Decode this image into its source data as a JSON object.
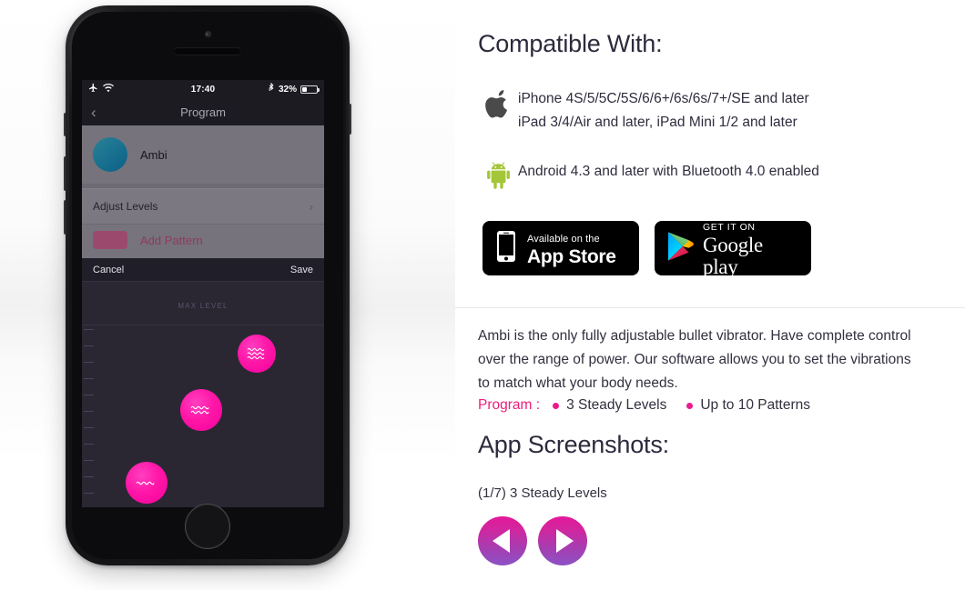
{
  "phone": {
    "status_bar": {
      "airplane_icon": "airplane-mode-icon",
      "wifi_icon": "wifi-icon",
      "time": "17:40",
      "bluetooth_icon": "bluetooth-icon",
      "battery_percent": "32%",
      "battery_level": 32
    },
    "nav": {
      "back_icon": "chevron-left-icon",
      "title": "Program"
    },
    "list": {
      "device_name": "Ambi",
      "adjust_levels": "Adjust Levels",
      "adjust_chevron": "chevron-right-icon",
      "add_pattern": "Add Pattern"
    },
    "sheet": {
      "cancel": "Cancel",
      "save": "Save",
      "max_level_label": "MAX LEVEL",
      "bubbles": [
        {
          "waves": 3,
          "name": "level-bubble-high"
        },
        {
          "waves": 2,
          "name": "level-bubble-mid"
        },
        {
          "waves": 1,
          "name": "level-bubble-low"
        }
      ]
    }
  },
  "compatible": {
    "heading": "Compatible With:",
    "apple": {
      "icon": "apple-logo-icon",
      "line1": "iPhone 4S/5/5C/5S/6/6+/6s/6s/7+/SE and later",
      "line2": "iPad 3/4/Air and later, iPad Mini 1/2 and later"
    },
    "android": {
      "icon": "android-logo-icon",
      "line1": "Android 4.3 and later with Bluetooth 4.0 enabled"
    }
  },
  "badges": {
    "app_store": {
      "icon": "iphone-device-icon",
      "line1": "Available on the",
      "line2": "App Store"
    },
    "google_play": {
      "icon": "google-play-triangle-icon",
      "line1": "GET IT ON",
      "line2_bold": "Google",
      "line2_light": "play"
    }
  },
  "description": {
    "paragraph": "Ambi is the only fully adjustable bullet vibrator. Have complete control over the range of power. Our software allows you to set the vibrations to match what your body needs.",
    "program_label": "Program :",
    "program_items": [
      "3 Steady Levels",
      "Up to 10 Patterns"
    ]
  },
  "screenshots": {
    "heading": "App Screenshots:",
    "caption": "(1/7) 3 Steady Levels",
    "prev_icon": "arrow-left-icon",
    "next_icon": "arrow-right-icon"
  },
  "colors": {
    "accent_pink": "#ed1e79",
    "bullet_pink": "#ec1a8d",
    "gradient_start": "#e2189a",
    "gradient_end": "#8b52c4",
    "android_green": "#a4c639",
    "heading_dark": "#2d2a3d"
  }
}
